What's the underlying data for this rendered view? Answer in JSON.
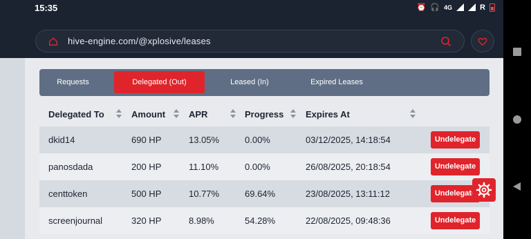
{
  "status": {
    "time": "15:35",
    "network": "4G",
    "carrier": "R"
  },
  "browser": {
    "url": "hive-engine.com/@xplosive/leases"
  },
  "tabs": [
    {
      "label": "Requests",
      "active": false
    },
    {
      "label": "Delegated (Out)",
      "active": true
    },
    {
      "label": "Leased (In)",
      "active": false
    },
    {
      "label": "Expired Leases",
      "active": false
    }
  ],
  "table": {
    "headers": [
      "Delegated To",
      "Amount",
      "APR",
      "Progress",
      "Expires At"
    ],
    "rows": [
      {
        "to": "dkid14",
        "amount": "690 HP",
        "apr": "13.05%",
        "progress": "0.00%",
        "expires": "03/12/2025, 14:18:54",
        "action": "Undelegate"
      },
      {
        "to": "panosdada",
        "amount": "200 HP",
        "apr": "11.10%",
        "progress": "0.00%",
        "expires": "26/08/2025, 20:18:54",
        "action": "Undelegate"
      },
      {
        "to": "centtoken",
        "amount": "500 HP",
        "apr": "10.77%",
        "progress": "69.64%",
        "expires": "23/08/2025, 13:11:12",
        "action": "Undelegate"
      },
      {
        "to": "screenjournal",
        "amount": "320 HP",
        "apr": "8.98%",
        "progress": "54.28%",
        "expires": "22/08/2025, 09:48:36",
        "action": "Undelegate"
      }
    ]
  },
  "colors": {
    "accent": "#e0242b",
    "header_bg": "#1b2230",
    "tab_bar": "#5f6e84"
  }
}
